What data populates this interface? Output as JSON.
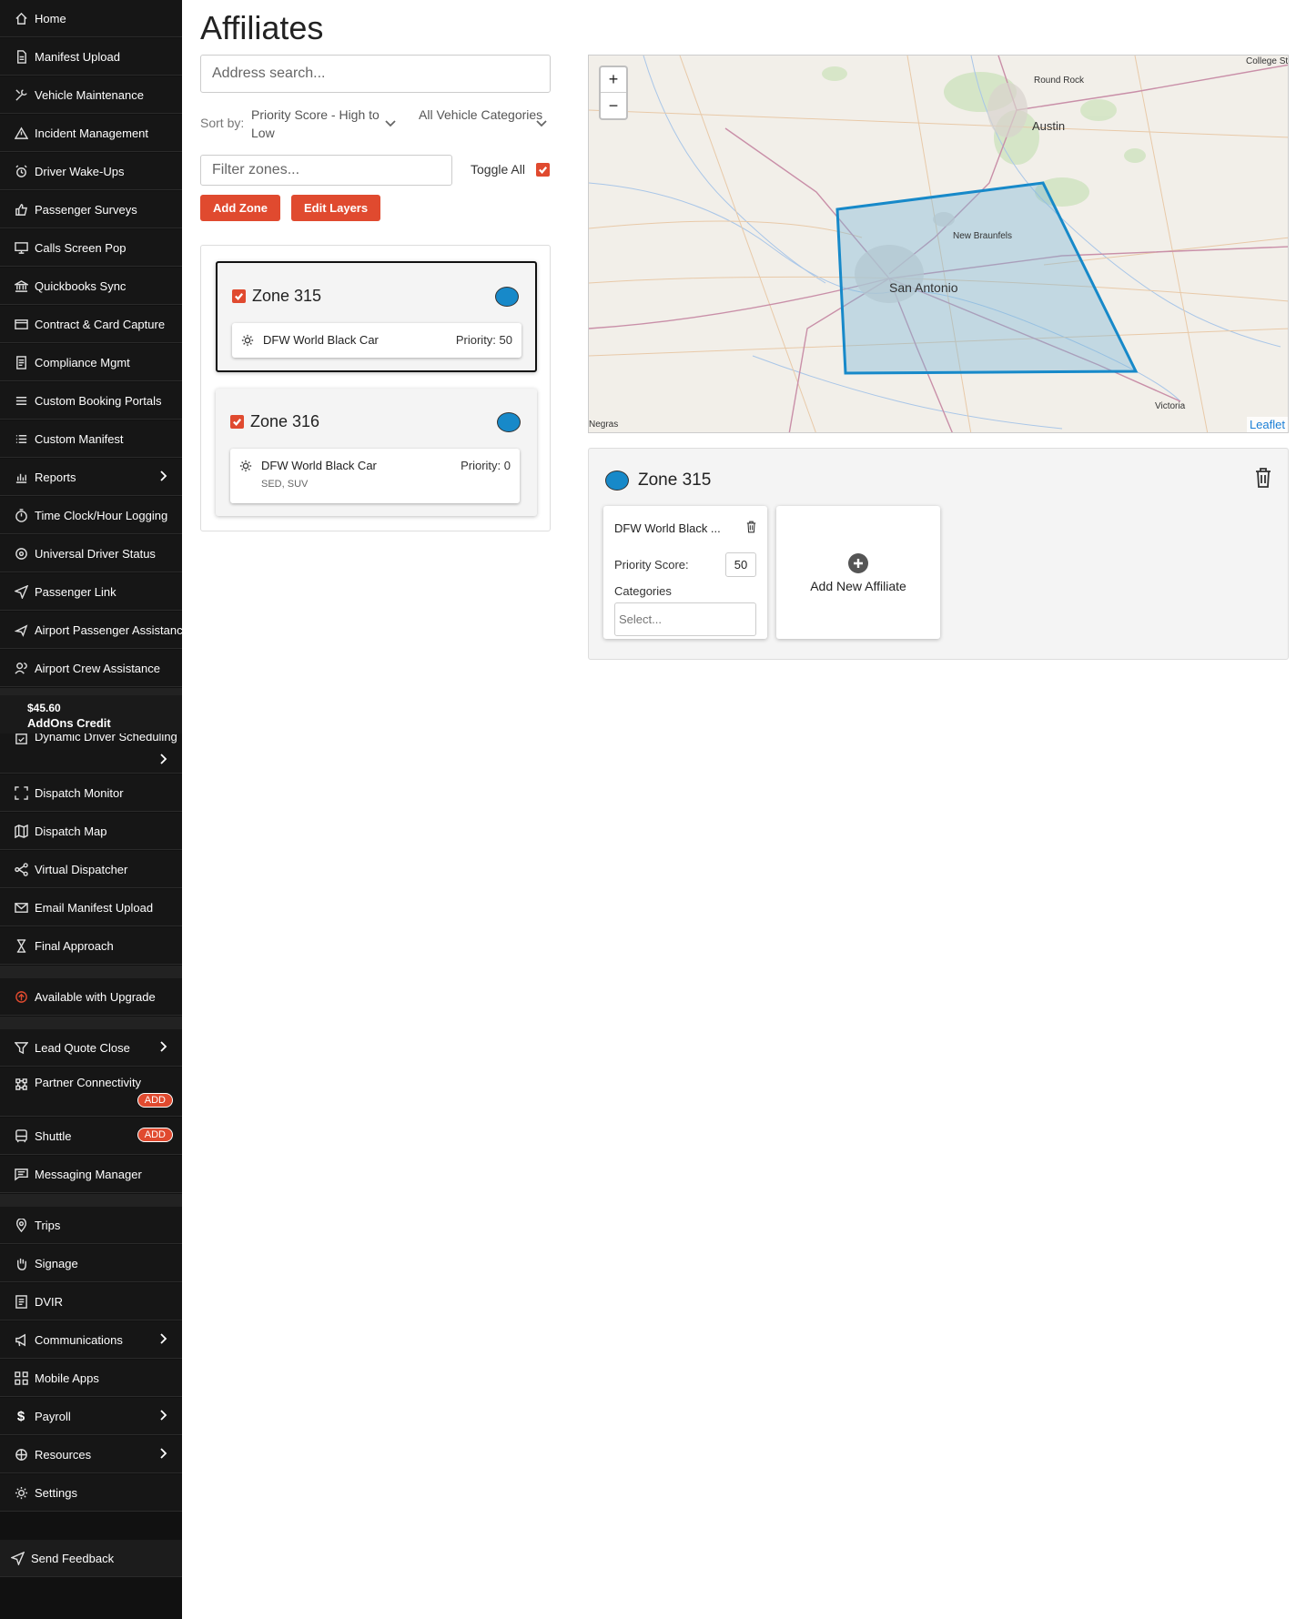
{
  "sidebar": {
    "items": [
      {
        "label": "Home",
        "icon": "home-icon"
      },
      {
        "label": "Manifest Upload",
        "icon": "file-icon"
      },
      {
        "label": "Vehicle Maintenance",
        "icon": "wrench-icon"
      },
      {
        "label": "Incident Management",
        "icon": "warning-icon"
      },
      {
        "label": "Driver Wake-Ups",
        "icon": "alarm-icon"
      },
      {
        "label": "Passenger Surveys",
        "icon": "thumbs-up-icon"
      },
      {
        "label": "Calls Screen Pop",
        "icon": "monitor-icon"
      },
      {
        "label": "Quickbooks Sync",
        "icon": "bank-icon"
      },
      {
        "label": "Contract & Card Capture",
        "icon": "card-icon"
      },
      {
        "label": "Compliance Mgmt",
        "icon": "document-icon"
      },
      {
        "label": "Custom Booking Portals",
        "icon": "portal-icon"
      },
      {
        "label": "Custom Manifest",
        "icon": "list-icon"
      },
      {
        "label": "Reports",
        "icon": "bar-chart-icon"
      },
      {
        "label": "Time Clock/Hour Logging",
        "icon": "stopwatch-icon"
      },
      {
        "label": "Universal Driver Status",
        "icon": "target-icon"
      },
      {
        "label": "Passenger Link",
        "icon": "send-icon"
      },
      {
        "label": "Airport Passenger Assistance",
        "icon": "plane-icon"
      },
      {
        "label": "Airport Crew Assistance",
        "icon": "users-icon"
      }
    ],
    "credit": {
      "amount": "$45.60",
      "label": "AddOns Credit"
    },
    "scheduling_label": "Dynamic Driver Scheduling",
    "dispatch_items": [
      {
        "label": "Dispatch Monitor",
        "icon": "scan-icon"
      },
      {
        "label": "Dispatch Map",
        "icon": "map-icon"
      },
      {
        "label": "Virtual Dispatcher",
        "icon": "share-icon"
      },
      {
        "label": "Email Manifest Upload",
        "icon": "mail-icon"
      },
      {
        "label": "Final Approach",
        "icon": "hourglass-icon"
      }
    ],
    "upgrade_label": "Available with Upgrade",
    "addon_items": [
      {
        "label": "Lead Quote Close",
        "icon": "funnel-icon"
      },
      {
        "label": "Partner Connectivity",
        "icon": "network-icon",
        "badge": "ADD"
      },
      {
        "label": "Shuttle",
        "icon": "bus-icon",
        "badge": "ADD"
      },
      {
        "label": "Messaging Manager",
        "icon": "message-icon"
      }
    ],
    "bottom_items": [
      {
        "label": "Trips",
        "icon": "pin-icon"
      },
      {
        "label": "Signage",
        "icon": "hand-icon"
      },
      {
        "label": "DVIR",
        "icon": "checklist-icon"
      },
      {
        "label": "Communications",
        "icon": "megaphone-icon"
      },
      {
        "label": "Mobile Apps",
        "icon": "apps-icon"
      },
      {
        "label": "Payroll",
        "icon": "dollar-icon"
      },
      {
        "label": "Resources",
        "icon": "resources-icon"
      },
      {
        "label": "Settings",
        "icon": "gear-icon"
      }
    ],
    "feedback_label": "Send Feedback"
  },
  "main": {
    "title": "Affiliates",
    "address_placeholder": "Address search...",
    "sort_label": "Sort by:",
    "sort_value": "Priority Score - High to Low",
    "category_value": "All Vehicle Categories",
    "filter_placeholder": "Filter zones...",
    "toggle_all_label": "Toggle All",
    "add_zone_label": "Add Zone",
    "edit_layers_label": "Edit Layers",
    "zones": [
      {
        "name": "Zone 315",
        "affiliate": "DFW World Black Car",
        "priority": "Priority: 50",
        "categories": ""
      },
      {
        "name": "Zone 316",
        "affiliate": "DFW World Black Car",
        "priority": "Priority: 0",
        "categories": "SED, SUV"
      }
    ],
    "zone_color": "#1789c9",
    "accent_color": "#e04a2f"
  },
  "map": {
    "zoom_in": "+",
    "zoom_out": "−",
    "labels": [
      "College St",
      "Round Rock",
      "Austin",
      "New Braunfels",
      "San Antonio",
      "Victoria",
      "Negras"
    ],
    "attribution": "Leaflet"
  },
  "detail": {
    "zone_name": "Zone 315",
    "affiliate_name": "DFW World Black ...",
    "priority_label": "Priority Score:",
    "priority_value": "50",
    "categories_label": "Categories",
    "categories_placeholder": "Select...",
    "add_label": "Add New Affiliate"
  }
}
